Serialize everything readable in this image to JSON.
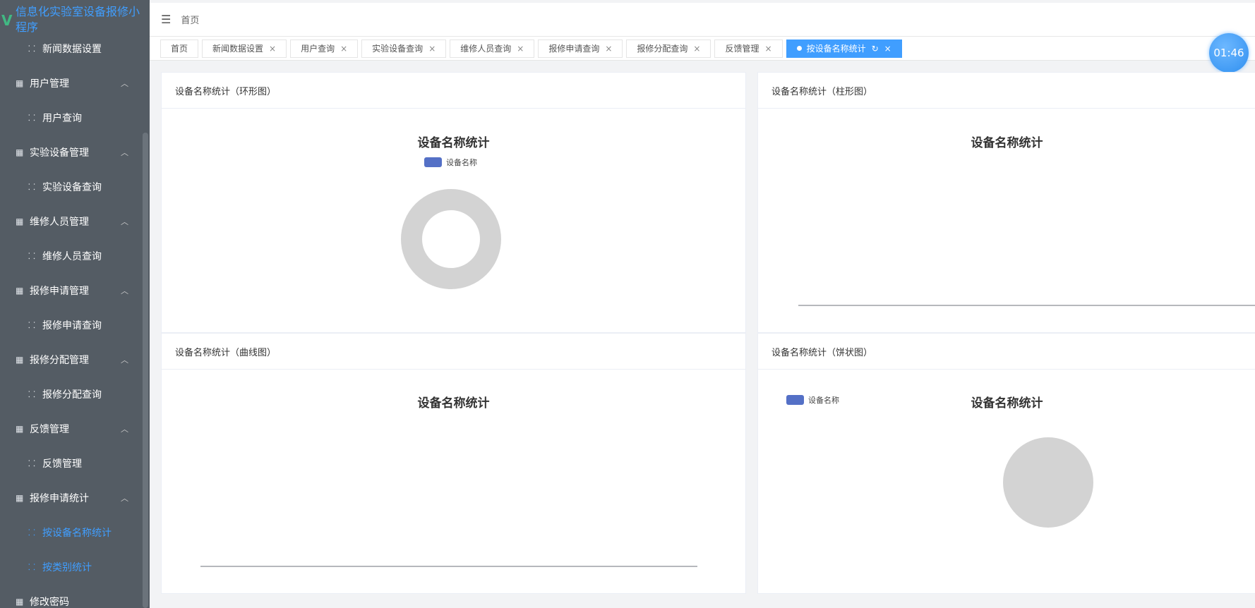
{
  "app": {
    "title": "信息化实验室设备报修小程序"
  },
  "sidebar": {
    "items": [
      {
        "label": "新闻数据设置",
        "type": "sub"
      },
      {
        "label": "用户管理",
        "type": "group"
      },
      {
        "label": "用户查询",
        "type": "sub"
      },
      {
        "label": "实验设备管理",
        "type": "group"
      },
      {
        "label": "实验设备查询",
        "type": "sub"
      },
      {
        "label": "维修人员管理",
        "type": "group"
      },
      {
        "label": "维修人员查询",
        "type": "sub"
      },
      {
        "label": "报修申请管理",
        "type": "group"
      },
      {
        "label": "报修申请查询",
        "type": "sub"
      },
      {
        "label": "报修分配管理",
        "type": "group"
      },
      {
        "label": "报修分配查询",
        "type": "sub"
      },
      {
        "label": "反馈管理",
        "type": "group"
      },
      {
        "label": "反馈管理",
        "type": "sub"
      },
      {
        "label": "报修申请统计",
        "type": "group"
      },
      {
        "label": "按设备名称统计",
        "type": "sub",
        "active": true
      },
      {
        "label": "按类别统计",
        "type": "sub",
        "active": true
      },
      {
        "label": "修改密码",
        "type": "group"
      }
    ]
  },
  "header": {
    "breadcrumb": "首页"
  },
  "tabs": [
    {
      "label": "首页",
      "closable": false
    },
    {
      "label": "新闻数据设置",
      "closable": true
    },
    {
      "label": "用户查询",
      "closable": true
    },
    {
      "label": "实验设备查询",
      "closable": true
    },
    {
      "label": "维修人员查询",
      "closable": true
    },
    {
      "label": "报修申请查询",
      "closable": true
    },
    {
      "label": "报修分配查询",
      "closable": true
    },
    {
      "label": "反馈管理",
      "closable": true
    },
    {
      "label": "按设备名称统计",
      "closable": true,
      "active": true
    }
  ],
  "timer": "01:46",
  "panels": {
    "donut": {
      "header": "设备名称统计（环形图）",
      "title": "设备名称统计",
      "legend": "设备名称"
    },
    "bar": {
      "header": "设备名称统计（柱形图）",
      "title": "设备名称统计"
    },
    "line": {
      "header": "设备名称统计（曲线图）",
      "title": "设备名称统计"
    },
    "pie": {
      "header": "设备名称统计（饼状图）",
      "title": "设备名称统计",
      "legend": "设备名称"
    }
  },
  "colors": {
    "sidebar": "#545c64",
    "accent": "#409eff",
    "legend": "#5470c6",
    "empty_chart": "#d3d3d3"
  }
}
